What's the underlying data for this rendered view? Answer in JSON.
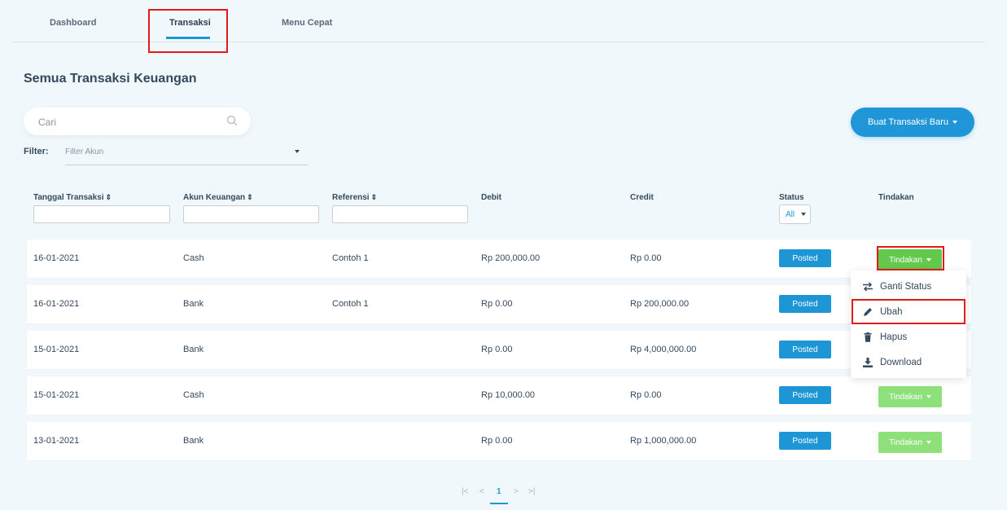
{
  "tabs": [
    "Dashboard",
    "Transaksi",
    "Menu Cepat"
  ],
  "page_title": "Semua Transaksi Keuangan",
  "search": {
    "placeholder": "Cari"
  },
  "new_button": "Buat Transaksi Baru",
  "filter": {
    "label": "Filter:",
    "placeholder": "Filter Akun"
  },
  "columns": {
    "date": "Tanggal Transaksi",
    "account": "Akun Keuangan",
    "reference": "Referensi",
    "debit": "Debit",
    "credit": "Credit",
    "status": "Status",
    "actions": "Tindakan"
  },
  "status_filter": "All",
  "sort_glyph": "⇕",
  "rows": [
    {
      "date": "16-01-2021",
      "account": "Cash",
      "reference": "Contoh 1",
      "debit": "Rp 200,000.00",
      "credit": "Rp 0.00",
      "status": "Posted",
      "action": "Tindakan"
    },
    {
      "date": "16-01-2021",
      "account": "Bank",
      "reference": "Contoh 1",
      "debit": "Rp 0.00",
      "credit": "Rp 200,000.00",
      "status": "Posted",
      "action": "Tindakan"
    },
    {
      "date": "15-01-2021",
      "account": "Bank",
      "reference": "",
      "debit": "Rp 0.00",
      "credit": "Rp 4,000,000.00",
      "status": "Posted",
      "action": "Tindakan"
    },
    {
      "date": "15-01-2021",
      "account": "Cash",
      "reference": "",
      "debit": "Rp 10,000.00",
      "credit": "Rp 0.00",
      "status": "Posted",
      "action": "Tindakan"
    },
    {
      "date": "13-01-2021",
      "account": "Bank",
      "reference": "",
      "debit": "Rp 0.00",
      "credit": "Rp 1,000,000.00",
      "status": "Posted",
      "action": "Tindakan"
    }
  ],
  "action_menu": {
    "items": [
      {
        "label": "Ganti Status",
        "icon": "swap-icon"
      },
      {
        "label": "Ubah",
        "icon": "pencil-icon"
      },
      {
        "label": "Hapus",
        "icon": "trash-icon"
      },
      {
        "label": "Download",
        "icon": "download-icon"
      }
    ]
  },
  "pagination": {
    "first": "|<",
    "prev": "<",
    "current": "1",
    "next": ">",
    "last": ">|"
  },
  "colors": {
    "accent": "#1e96d6",
    "action_green": "#8ee07a",
    "highlight": "#e01b1b"
  }
}
